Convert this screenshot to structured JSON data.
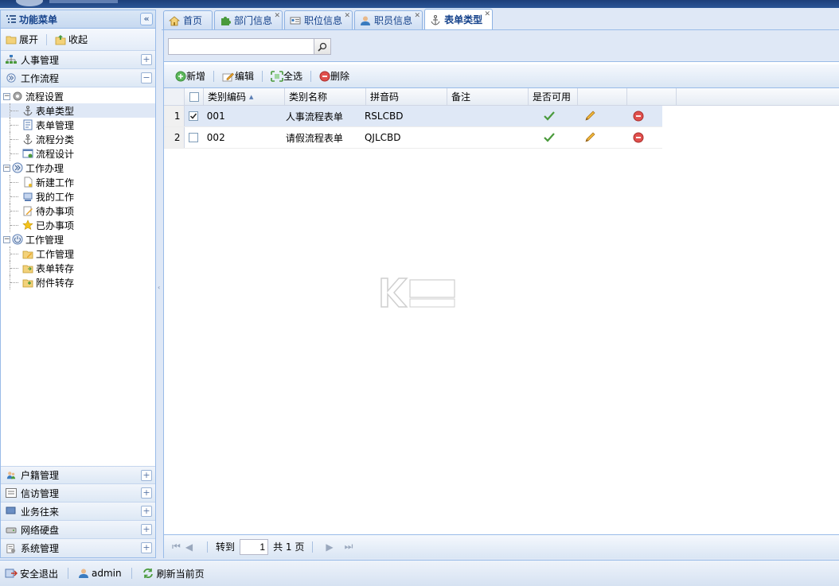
{
  "left": {
    "title": "功能菜单",
    "collapse_symbol": "«",
    "expand_label": "展开",
    "collapse_label": "收起",
    "sections_top": [
      {
        "label": "人事管理",
        "toggle": "+"
      },
      {
        "label": "工作流程",
        "toggle": "−"
      }
    ],
    "tree": [
      {
        "level": 0,
        "label": "流程设置",
        "toggle": "⊟"
      },
      {
        "level": 1,
        "label": "表单类型",
        "selected": true
      },
      {
        "level": 1,
        "label": "表单管理"
      },
      {
        "level": 1,
        "label": "流程分类"
      },
      {
        "level": 1,
        "label": "流程设计"
      },
      {
        "level": 0,
        "label": "工作办理",
        "toggle": "⊟"
      },
      {
        "level": 1,
        "label": "新建工作"
      },
      {
        "level": 1,
        "label": "我的工作"
      },
      {
        "level": 1,
        "label": "待办事项"
      },
      {
        "level": 1,
        "label": "已办事项"
      },
      {
        "level": 0,
        "label": "工作管理",
        "toggle": "⊟"
      },
      {
        "level": 1,
        "label": "工作管理"
      },
      {
        "level": 1,
        "label": "表单转存"
      },
      {
        "level": 1,
        "label": "附件转存"
      }
    ],
    "sections_bottom": [
      {
        "label": "户籍管理",
        "toggle": "+"
      },
      {
        "label": "信访管理",
        "toggle": "+"
      },
      {
        "label": "业务往来",
        "toggle": "+"
      },
      {
        "label": "网络硬盘",
        "toggle": "+"
      },
      {
        "label": "系统管理",
        "toggle": "+"
      }
    ]
  },
  "tabs": [
    {
      "label": "首页",
      "icon": "home-icon"
    },
    {
      "label": "部门信息",
      "icon": "puzzle-icon"
    },
    {
      "label": "职位信息",
      "icon": "card-icon"
    },
    {
      "label": "职员信息",
      "icon": "user-icon"
    },
    {
      "label": "表单类型",
      "icon": "anchor-icon",
      "active": true
    }
  ],
  "search": {
    "value": "",
    "placeholder": ""
  },
  "toolbar": {
    "add": "新增",
    "edit": "编辑",
    "select_all": "全选",
    "delete": "删除"
  },
  "grid": {
    "columns": [
      "类别编码",
      "类别名称",
      "拼音码",
      "备注",
      "是否可用",
      "",
      ""
    ],
    "sort_arrow": "▲",
    "rows": [
      {
        "num": "1",
        "checked": true,
        "code": "001",
        "name": "人事流程表单",
        "pinyin": "RSLCBD",
        "note": ""
      },
      {
        "num": "2",
        "checked": false,
        "code": "002",
        "name": "请假流程表单",
        "pinyin": "QJLCBD",
        "note": ""
      }
    ]
  },
  "pager": {
    "goto_label": "转到",
    "page_value": "1",
    "total_label": "共 1 页"
  },
  "status": {
    "logout": "安全退出",
    "user": "admin",
    "refresh": "刷新当前页"
  },
  "colors": {
    "border": "#99bbe8",
    "header_text": "#15428b",
    "selection": "#dfe8f6"
  }
}
